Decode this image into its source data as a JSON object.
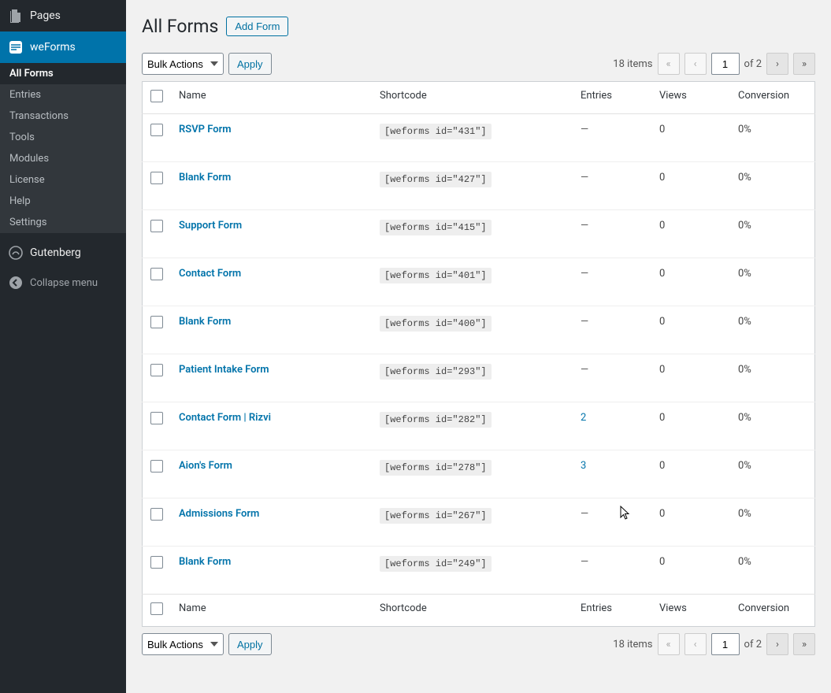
{
  "sidebar": {
    "pages": "Pages",
    "weforms": "weForms",
    "gutenberg": "Gutenberg",
    "collapse": "Collapse menu",
    "submenu": [
      "All Forms",
      "Entries",
      "Transactions",
      "Tools",
      "Modules",
      "License",
      "Help",
      "Settings"
    ]
  },
  "header": {
    "title": "All Forms",
    "add_form": "Add Form"
  },
  "bulk": {
    "label": "Bulk Actions",
    "apply": "Apply"
  },
  "pagination": {
    "items_text": "18 items",
    "current": "1",
    "of_text": "of 2"
  },
  "columns": {
    "name": "Name",
    "shortcode": "Shortcode",
    "entries": "Entries",
    "views": "Views",
    "conversion": "Conversion"
  },
  "rows": [
    {
      "name": "RSVP Form",
      "shortcode": "[weforms id=\"431\"]",
      "entries": "—",
      "entries_link": false,
      "views": "0",
      "conversion": "0%"
    },
    {
      "name": "Blank Form",
      "shortcode": "[weforms id=\"427\"]",
      "entries": "—",
      "entries_link": false,
      "views": "0",
      "conversion": "0%"
    },
    {
      "name": "Support Form",
      "shortcode": "[weforms id=\"415\"]",
      "entries": "—",
      "entries_link": false,
      "views": "0",
      "conversion": "0%"
    },
    {
      "name": "Contact Form",
      "shortcode": "[weforms id=\"401\"]",
      "entries": "—",
      "entries_link": false,
      "views": "0",
      "conversion": "0%"
    },
    {
      "name": "Blank Form",
      "shortcode": "[weforms id=\"400\"]",
      "entries": "—",
      "entries_link": false,
      "views": "0",
      "conversion": "0%"
    },
    {
      "name": "Patient Intake Form",
      "shortcode": "[weforms id=\"293\"]",
      "entries": "—",
      "entries_link": false,
      "views": "0",
      "conversion": "0%"
    },
    {
      "name": "Contact Form | Rizvi",
      "shortcode": "[weforms id=\"282\"]",
      "entries": "2",
      "entries_link": true,
      "views": "0",
      "conversion": "0%"
    },
    {
      "name": "Aion's Form",
      "shortcode": "[weforms id=\"278\"]",
      "entries": "3",
      "entries_link": true,
      "views": "0",
      "conversion": "0%"
    },
    {
      "name": "Admissions Form",
      "shortcode": "[weforms id=\"267\"]",
      "entries": "—",
      "entries_link": false,
      "views": "0",
      "conversion": "0%"
    },
    {
      "name": "Blank Form",
      "shortcode": "[weforms id=\"249\"]",
      "entries": "—",
      "entries_link": false,
      "views": "0",
      "conversion": "0%"
    }
  ]
}
